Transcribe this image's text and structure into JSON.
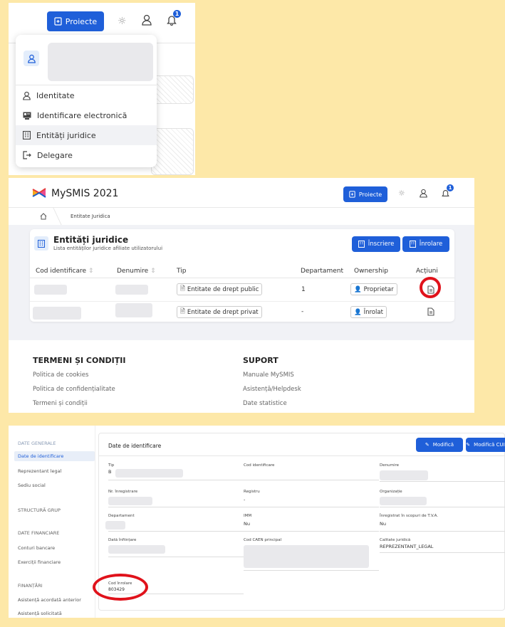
{
  "panel1": {
    "projects_label": "Proiecte",
    "notif_count": "1",
    "menu_items": [
      "Identitate",
      "Identificare electronică",
      "Entități juridice",
      "Delegare"
    ]
  },
  "panel2": {
    "app_title": "MySMIS 2021",
    "projects_label": "Proiecte",
    "notif_count": "1",
    "breadcrumb": "Entitate Juridica",
    "page_title": "Entități juridice",
    "page_subtitle": "Lista entităților juridice afiliate utilizatorului",
    "btn_inscriere": "Înscriere",
    "btn_inrolare": "Înrolare",
    "columns": [
      "Cod identificare",
      "Denumire",
      "Tip",
      "Departament",
      "Ownership",
      "Acțiuni"
    ],
    "rows": [
      {
        "tip": "Entitate de drept public",
        "departament": "1",
        "ownership": "Proprietar"
      },
      {
        "tip": "Entitate de drept privat",
        "departament": "-",
        "ownership": "Înrolat"
      }
    ],
    "footer_left_title": "TERMENI ȘI CONDIȚII",
    "footer_left_links": [
      "Politica de cookies",
      "Politica de confidențialitate",
      "Termeni și condiții"
    ],
    "footer_right_title": "SUPORT",
    "footer_right_links": [
      "Manuale MySMIS",
      "Asistență/Helpdesk",
      "Date statistice"
    ]
  },
  "panel3": {
    "sidebar": [
      {
        "label": "DATE GENERALE",
        "type": "heading"
      },
      {
        "label": "Date de identificare",
        "type": "active"
      },
      {
        "label": "Reprezentant legal",
        "type": "item"
      },
      {
        "label": "Sediu social",
        "type": "item"
      },
      {
        "label": "STRUCTURĂ GRUP",
        "type": "heading-dark"
      },
      {
        "label": "DATE FINANCIARE",
        "type": "heading-dark"
      },
      {
        "label": "Conturi bancare",
        "type": "item"
      },
      {
        "label": "Exerciții financiare",
        "type": "item"
      },
      {
        "label": "FINANȚĂRI",
        "type": "heading-dark"
      },
      {
        "label": "Asistență acordată anterior",
        "type": "item"
      },
      {
        "label": "Asistență solicitată",
        "type": "item"
      }
    ],
    "section_title": "Date de identificare",
    "btn_modifica": "Modifică",
    "btn_modifica_cui": "Modifică CUI",
    "fields": {
      "tip": {
        "label": "Tip",
        "value": "Β"
      },
      "cod_identificare": {
        "label": "Cod identificare"
      },
      "denumire": {
        "label": "Denumire"
      },
      "nr_inregistrare": {
        "label": "Nr. înregistrare"
      },
      "registru": {
        "label": "Registru",
        "value": "-"
      },
      "organizatie": {
        "label": "Organizație"
      },
      "departament": {
        "label": "Departament"
      },
      "imm": {
        "label": "IMM",
        "value": "Nu"
      },
      "tva": {
        "label": "Înregistrat în scopuri de T.V.A.",
        "value": "Nu"
      },
      "data_infiintare": {
        "label": "Dată înființare"
      },
      "cod_caen": {
        "label": "Cod CAEN principal"
      },
      "calitate": {
        "label": "Calitate juridică",
        "value": "REPREZENTANT_LEGAL"
      },
      "cod_inrolare": {
        "label": "Cod înrolare",
        "value": "803429"
      }
    }
  },
  "colors": {
    "accent": "#1f5fd9",
    "highlight": "#e0121b",
    "backdrop": "#fde8a8"
  }
}
